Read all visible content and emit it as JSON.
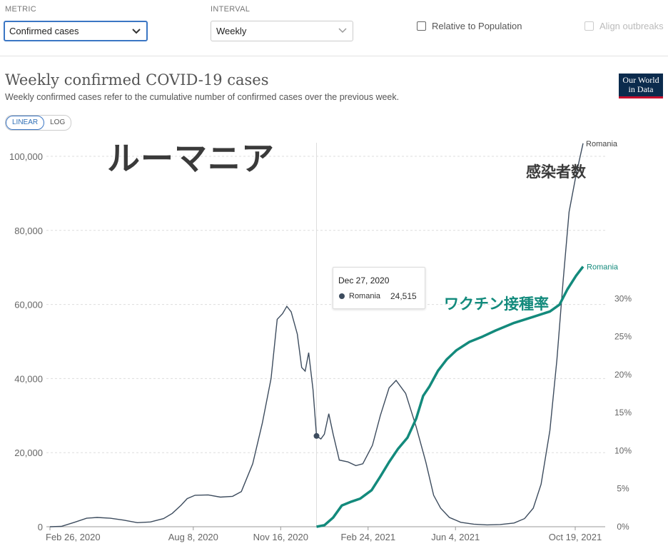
{
  "controls": {
    "metric_label": "METRIC",
    "metric_value": "Confirmed cases",
    "interval_label": "INTERVAL",
    "interval_value": "Weekly",
    "relative_label": "Relative to Population",
    "align_label": "Align outbreaks"
  },
  "header": {
    "title": "Weekly confirmed COVID-19 cases",
    "subtitle": "Weekly confirmed cases refer to the cumulative number of confirmed cases over the previous week.",
    "logo_line1": "Our World",
    "logo_line2": "in Data"
  },
  "scale_toggle": {
    "linear": "LINEAR",
    "log": "LOG",
    "selected": "LINEAR"
  },
  "annotations": {
    "country_jp": "ルーマニア",
    "cases_jp": "感染者数",
    "vaccination_jp": "ワクチン接種率"
  },
  "tooltip": {
    "date": "Dec 27, 2020",
    "entity": "Romania",
    "value": "24,515"
  },
  "colors": {
    "cases": "#3d4c5e",
    "vaccination": "#138a7c",
    "grid": "#dddddd",
    "accent": "#3b76c4"
  },
  "chart_data": [
    {
      "type": "line",
      "title": "Weekly confirmed COVID-19 cases",
      "x_axis": {
        "type": "date",
        "ticks": [
          "2020-02-26",
          "2020-08-08",
          "2020-11-16",
          "2021-02-24",
          "2021-06-04",
          "2021-10-19"
        ],
        "tick_labels": [
          "Feb 26, 2020",
          "Aug 8, 2020",
          "Nov 16, 2020",
          "Feb 24, 2021",
          "Jun 4, 2021",
          "Oct 19, 2021"
        ],
        "range": [
          "2020-02-26",
          "2021-11-05"
        ]
      },
      "y_axis": {
        "range": [
          0,
          100000
        ],
        "ticks": [
          0,
          20000,
          40000,
          60000,
          80000,
          100000
        ],
        "tick_labels": [
          "0",
          "20,000",
          "40,000",
          "60,000",
          "80,000",
          "100,000"
        ]
      },
      "grid": true,
      "series": [
        {
          "name": "Romania",
          "points": [
            [
              "2020-02-26",
              0
            ],
            [
              "2020-03-10",
              100
            ],
            [
              "2020-03-25",
              1200
            ],
            [
              "2020-04-08",
              2300
            ],
            [
              "2020-04-20",
              2500
            ],
            [
              "2020-05-05",
              2300
            ],
            [
              "2020-05-20",
              1800
            ],
            [
              "2020-06-05",
              1100
            ],
            [
              "2020-06-20",
              1300
            ],
            [
              "2020-07-05",
              2200
            ],
            [
              "2020-07-15",
              3600
            ],
            [
              "2020-07-25",
              5800
            ],
            [
              "2020-08-01",
              7600
            ],
            [
              "2020-08-10",
              8500
            ],
            [
              "2020-08-25",
              8600
            ],
            [
              "2020-09-08",
              8000
            ],
            [
              "2020-09-22",
              8200
            ],
            [
              "2020-10-02",
              9500
            ],
            [
              "2020-10-15",
              17000
            ],
            [
              "2020-10-26",
              28000
            ],
            [
              "2020-11-05",
              40000
            ],
            [
              "2020-11-12",
              56000
            ],
            [
              "2020-11-18",
              57500
            ],
            [
              "2020-11-23",
              59500
            ],
            [
              "2020-11-28",
              58000
            ],
            [
              "2020-12-05",
              52000
            ],
            [
              "2020-12-10",
              43000
            ],
            [
              "2020-12-14",
              42000
            ],
            [
              "2020-12-18",
              47000
            ],
            [
              "2020-12-23",
              37000
            ],
            [
              "2020-12-27",
              24515
            ],
            [
              "2021-01-01",
              23700
            ],
            [
              "2021-01-05",
              25000
            ],
            [
              "2021-01-10",
              30500
            ],
            [
              "2021-01-15",
              25000
            ],
            [
              "2021-01-22",
              18000
            ],
            [
              "2021-02-01",
              17500
            ],
            [
              "2021-02-10",
              16500
            ],
            [
              "2021-02-18",
              17000
            ],
            [
              "2021-03-01",
              22000
            ],
            [
              "2021-03-10",
              30000
            ],
            [
              "2021-03-20",
              37500
            ],
            [
              "2021-03-28",
              39500
            ],
            [
              "2021-04-08",
              36000
            ],
            [
              "2021-04-20",
              27000
            ],
            [
              "2021-05-01",
              17500
            ],
            [
              "2021-05-10",
              8500
            ],
            [
              "2021-05-18",
              5000
            ],
            [
              "2021-05-28",
              2500
            ],
            [
              "2021-06-10",
              1200
            ],
            [
              "2021-06-25",
              700
            ],
            [
              "2021-07-10",
              500
            ],
            [
              "2021-07-25",
              600
            ],
            [
              "2021-08-10",
              1000
            ],
            [
              "2021-08-22",
              2200
            ],
            [
              "2021-09-01",
              5000
            ],
            [
              "2021-09-10",
              11500
            ],
            [
              "2021-09-20",
              26000
            ],
            [
              "2021-09-28",
              45000
            ],
            [
              "2021-10-05",
              66000
            ],
            [
              "2021-10-12",
              85000
            ],
            [
              "2021-10-20",
              95000
            ],
            [
              "2021-10-28",
              103500
            ]
          ]
        }
      ],
      "hover": {
        "date": "2020-12-27",
        "value": 24515
      }
    },
    {
      "type": "line",
      "y_axis": {
        "range": [
          0,
          35
        ],
        "ticks": [
          0,
          5,
          10,
          15,
          20,
          25,
          30
        ],
        "tick_labels": [
          "0%",
          "5%",
          "10%",
          "15%",
          "20%",
          "25%",
          "30%"
        ]
      },
      "series": [
        {
          "name": "Romania",
          "points": [
            [
              "2020-12-27",
              0
            ],
            [
              "2021-01-05",
              0.2
            ],
            [
              "2021-01-15",
              1.2
            ],
            [
              "2021-01-25",
              2.8
            ],
            [
              "2021-02-05",
              3.3
            ],
            [
              "2021-02-15",
              3.7
            ],
            [
              "2021-02-28",
              4.8
            ],
            [
              "2021-03-10",
              6.6
            ],
            [
              "2021-03-20",
              8.5
            ],
            [
              "2021-03-30",
              10.2
            ],
            [
              "2021-04-10",
              11.7
            ],
            [
              "2021-04-20",
              14.2
            ],
            [
              "2021-04-28",
              17.2
            ],
            [
              "2021-05-05",
              18.4
            ],
            [
              "2021-05-15",
              20.5
            ],
            [
              "2021-05-25",
              22.0
            ],
            [
              "2021-06-05",
              23.2
            ],
            [
              "2021-06-20",
              24.3
            ],
            [
              "2021-07-05",
              25.0
            ],
            [
              "2021-07-20",
              25.8
            ],
            [
              "2021-08-10",
              26.8
            ],
            [
              "2021-09-01",
              27.6
            ],
            [
              "2021-09-20",
              28.3
            ],
            [
              "2021-10-01",
              29.2
            ],
            [
              "2021-10-10",
              31.2
            ],
            [
              "2021-10-20",
              33.0
            ],
            [
              "2021-10-28",
              34.2
            ]
          ]
        }
      ]
    }
  ]
}
